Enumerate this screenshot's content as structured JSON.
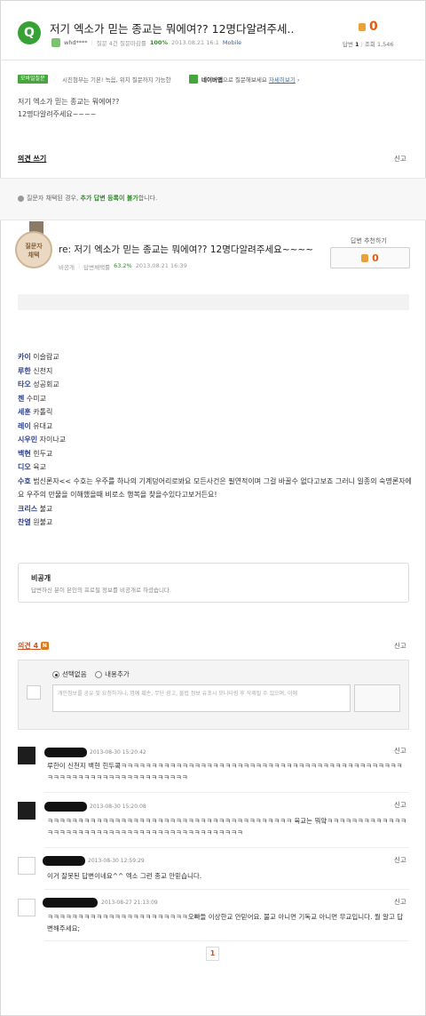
{
  "question": {
    "badge": "Q",
    "title": "저기 엑소가 믿는 종교는 뭐에여?? 12명다알려주세..",
    "user": "whd****",
    "stats_text": "질문 4건 질문마감률",
    "close_rate": "100%",
    "date": "2013.08.21 16:1",
    "mobile": "Mobile",
    "vote_count": "0",
    "answer_label": "답변",
    "answer_count": "1",
    "view_label": "조회",
    "view_count": "1,546",
    "body_line1": "저기 엑소가 믿는 종교는 뭐에여??",
    "body_line2": "12명다알려주세요~~~~"
  },
  "notice": {
    "mobile_badge": "모바일질문",
    "text": "시진첨부는 기본! 녹음, 위치 질문까지 가능한",
    "naver_app": "네이버앱",
    "naver_suffix": "으로 질문해보세요",
    "detail_link": "자세히보기"
  },
  "actions": {
    "write_opinion": "의견 쓰기",
    "report": "신고"
  },
  "info": {
    "text_pre": "질문자 채택된 경우,",
    "text_bold": "추가 답변 등록이 불가",
    "text_post": "합니다."
  },
  "answer": {
    "medal_line1": "질문자",
    "medal_line2": "채택",
    "title": "re: 저기 엑소가 믿는 종교는 뭐에여?? 12명다알려주세요~~~~",
    "user": "비공개",
    "rate_label": "답변채택률",
    "rate": "63.2%",
    "date": "2013.08.21 16:39",
    "recommend_label": "답변 추천하기",
    "recommend_count": "0",
    "lines": [
      {
        "name": "카이",
        "text": "이슬람교"
      },
      {
        "name": "루한",
        "text": "신천지"
      },
      {
        "name": "타오",
        "text": "성공회교"
      },
      {
        "name": "첸",
        "text": "수미교"
      },
      {
        "name": "세훈",
        "text": "카톨릭"
      },
      {
        "name": "레이",
        "text": "유대교"
      },
      {
        "name": "시우민",
        "text": "자이나교"
      },
      {
        "name": "백현",
        "text": "힌두교"
      },
      {
        "name": "디오",
        "text": "육교"
      },
      {
        "name": "수호",
        "text": "범신론자<< 수호는 우주를 하나의 기계덩어리로봐요 모든사건은 필연적이며 그걸 바꿀수 없다고보죠  그러니 일종의 숙명론자에요 우주의 만물을 이해했을때 비로소 행복을 찾을수있다고보거든요!"
      },
      {
        "name": "크리스",
        "text": "불교"
      },
      {
        "name": "찬열",
        "text": "원불교"
      }
    ]
  },
  "private": {
    "title": "비공개",
    "desc": "답변하신 분이 본인의 프로필 정보를 비공개로 하셨습니다."
  },
  "comments_section": {
    "label": "의견",
    "count": "4",
    "badge": "N",
    "option_none": "선택없음",
    "option_add": "내용추가",
    "placeholder": "개인정보를 공유 및 요청하거나, 명예 훼손, 무단 광고, 불법 정보 유포시 모니터링 후 삭제될 수 있으며, 이에"
  },
  "comments": [
    {
      "date": "2013-08-30 15:20:42",
      "text": "루한이 신천지 백현 힌두콬ㅋㅋㅋㅋㅋㅋㅋㅋㅋㅋㅋㅋㅋㅋㅋㅋㅋㅋㅋㅋㅋㅋㅋㅋㅋㅋㅋㅋㅋㅋㅋㅋㅋㅋㅋㅋㅋㅋㅋㅋㅋㅋㅋㅋㅋㅋㅋㅋㅋㅋㅋㅋㅋㅋㅋㅋㅋㅋㅋㅋㅋㅋㅋㅋㅋㅋㅋㅋㅋ",
      "report": "신고"
    },
    {
      "date": "2013-08-30 15:20:08",
      "text": "ㅋㅋㅋㅋㅋㅋㅋㅋㅋㅋㅋㅋㅋㅋㅋㅋㅋㅋㅋㅋㅋㅋㅋㅋㅋㅋㅋㅋㅋㅋㅋㅋㅋㅋㅋㅋㅋㅋㅋㅋ 육교는 뭐얔ㅋㅋㅋㅋㅋㅋㅋㅋㅋㅋㅋㅋㅋㅋㅋㅋㅋㅋㅋㅋㅋㅋㅋㅋㅋㅋㅋㅋㅋㅋㅋㅋㅋㅋㅋㅋㅋㅋㅋㅋㅋㅋㅋㅋㅋ",
      "report": "신고"
    },
    {
      "date": "2013-08-30 12:59:29",
      "text": "이거 잘못된 답변이네요^^ 엑소 그런 종교 안믿습니다.",
      "report": "신고"
    },
    {
      "date": "2013-08-27 21:13:09",
      "text": "ㅋㅋㅋㅋㅋㅋㅋㅋㅋㅋㅋㅋㅋㅋㅋㅋㅋㅋㅋㅋㅋㅋㅋ오빠들 이상한교 안믿어요. 불교 아니면 기독교 아니면 무교입니다. 뭘 알고 답변해주세요;",
      "report": "신고"
    }
  ],
  "pagination": {
    "current": "1"
  },
  "colors": {
    "accent_green": "#36a234",
    "vote_orange": "#e05d0e",
    "link_blue": "#2a3f8f"
  }
}
